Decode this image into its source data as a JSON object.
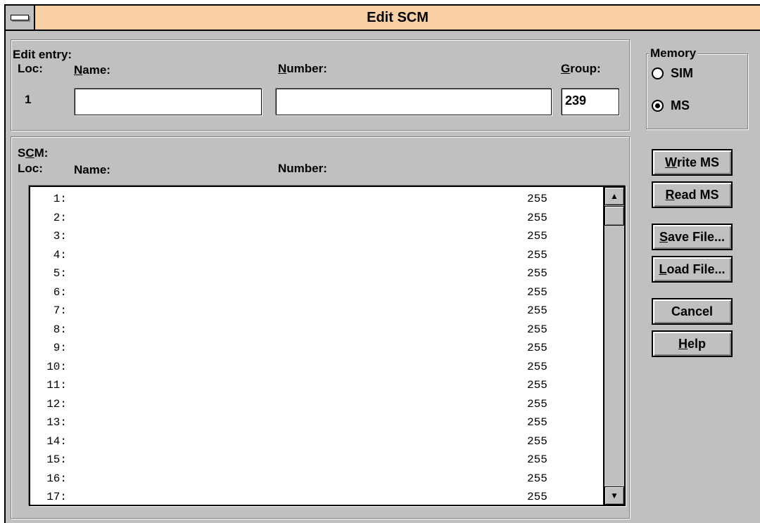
{
  "window": {
    "title": "Edit SCM"
  },
  "edit_entry": {
    "heading": "Edit entry:",
    "loc_label": "Loc:",
    "name_label": "Name:",
    "number_label": "Number:",
    "group_label": "Group:",
    "loc_value": "1",
    "name_value": "",
    "number_value": "",
    "group_value": "239"
  },
  "memory": {
    "heading": "Memory",
    "options": [
      {
        "label": "SIM",
        "selected": false
      },
      {
        "label": "MS",
        "selected": true
      }
    ]
  },
  "scm_list": {
    "heading": "SCM:",
    "loc_header": "Loc:",
    "name_header": "Name:",
    "number_header": "Number:",
    "rows": [
      {
        "loc": "1:",
        "name": "",
        "number": "",
        "group": "255"
      },
      {
        "loc": "2:",
        "name": "",
        "number": "",
        "group": "255"
      },
      {
        "loc": "3:",
        "name": "",
        "number": "",
        "group": "255"
      },
      {
        "loc": "4:",
        "name": "",
        "number": "",
        "group": "255"
      },
      {
        "loc": "5:",
        "name": "",
        "number": "",
        "group": "255"
      },
      {
        "loc": "6:",
        "name": "",
        "number": "",
        "group": "255"
      },
      {
        "loc": "7:",
        "name": "",
        "number": "",
        "group": "255"
      },
      {
        "loc": "8:",
        "name": "",
        "number": "",
        "group": "255"
      },
      {
        "loc": "9:",
        "name": "",
        "number": "",
        "group": "255"
      },
      {
        "loc": "10:",
        "name": "",
        "number": "",
        "group": "255"
      },
      {
        "loc": "11:",
        "name": "",
        "number": "",
        "group": "255"
      },
      {
        "loc": "12:",
        "name": "",
        "number": "",
        "group": "255"
      },
      {
        "loc": "13:",
        "name": "",
        "number": "",
        "group": "255"
      },
      {
        "loc": "14:",
        "name": "",
        "number": "",
        "group": "255"
      },
      {
        "loc": "15:",
        "name": "",
        "number": "",
        "group": "255"
      },
      {
        "loc": "16:",
        "name": "",
        "number": "",
        "group": "255"
      },
      {
        "loc": "17:",
        "name": "",
        "number": "",
        "group": "255"
      }
    ]
  },
  "buttons": {
    "write_ms": "Write MS",
    "read_ms": "Read MS",
    "save_file": "Save File...",
    "load_file": "Load File...",
    "cancel": "Cancel",
    "help": "Help"
  },
  "icons": {
    "system_menu": "system-menu-icon",
    "scroll_up": "arrow-up-icon",
    "scroll_down": "arrow-down-icon"
  }
}
